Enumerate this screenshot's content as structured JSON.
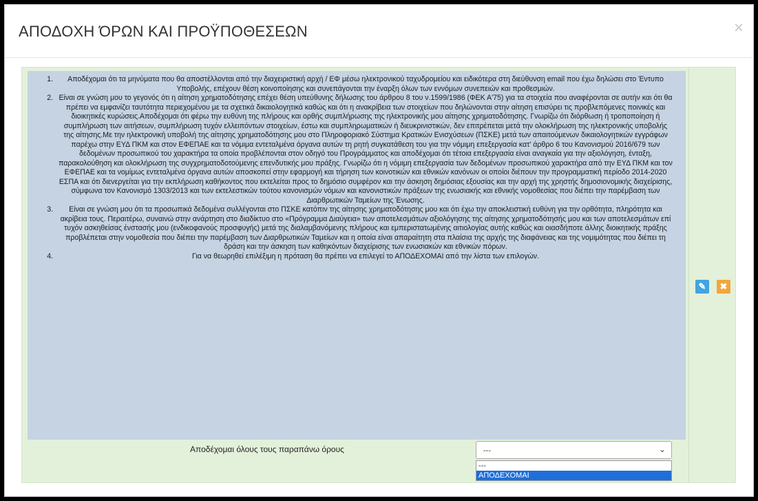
{
  "modal": {
    "title": "ΑΠΟΔΟΧΗ ΌΡΩΝ ΚΑΙ ΠΡΟΫΠΟΘΕΣΕΩΝ",
    "close_icon": "×"
  },
  "terms": [
    "Αποδέχομαι ότι τα μηνύματα που θα αποστέλλονται από την διαχειριστική αρχή / ΕΦ μέσω ηλεκτρονικού ταχυδρομείου και ειδικότερα στη διεύθυνση email που έχω δηλώσει στο Έντυπο Υποβολής, επέχουν θέση κοινοποίησης και συνεπάγονται την έναρξη όλων των εννόμων συνεπειών και προθεσμιών.",
    "Είναι σε γνώση μου το γεγονός ότι η αίτηση χρηματοδότησης επέχει θέση υπεύθυνης δήλωσης του άρθρου 8 του ν.1599/1986 (ΦΕΚ Α'75) για τα στοιχεία που αναφέρονται σε αυτήν και ότι θα πρέπει να εμφανίζει ταυτότητα περιεχομένου με τα σχετικά δικαιολογητικά καθώς και ότι η ανακρίβεια των στοιχείων που δηλώνονται στην αίτηση επισύρει τις προβλεπόμενες ποινικές και διοικητικές κυρώσεις.Αποδέχομαι ότι φέρω την ευθύνη της πλήρους και ορθής συμπλήρωσης της ηλεκτρονικής μου αίτησης χρηματοδότησης. Γνωρίζω ότι διόρθωση ή τροποποίηση ή συμπλήρωση των αιτήσεων, συμπλήρωση τυχόν ελλειπόντων στοιχείων, έστω και συμπληρωματικών ή διευκρινιστικών, δεν επιτρέπεται μετά την ολοκλήρωση της ηλεκτρονικής υποβολής της αίτησης.Με την ηλεκτρονική υποβολή της αίτησης χρηματοδότησης μου στο Πληροφοριακό Σύστημα Κρατικών Ενισχύσεων (ΠΣΚΕ) μετά των απαιτούμενων δικαιολογητικών εγγράφων παρέχω στην ΕΥΔ ΠΚΜ και στον ΕΦΕΠΑΕ και τα νόμιμα εντεταλμένα όργανα αυτών τη ρητή συγκατάθεση του για την νόμιμη επεξεργασία κατ' άρθρο 6 του Κανονισμού 2016/679 των δεδομένων προσωπικού του χαρακτήρα τα οποία προβλέπονται στον οδηγό του Προγράμματος και αποδέχομαι ότι τέτοια επεξεργασία είναι αναγκαία για την αξιολόγηση, ένταξη, παρακολούθηση και ολοκλήρωση της συγχρηματοδοτούμενης επενδυτικής μου πράξης. Γνωρίζω ότι η νόμιμη επεξεργασία των δεδομένων προσωπικού χαρακτήρα από την ΕΥΔ ΠΚΜ και τον ΕΦΕΠΑΕ και τα νομίμως εντεταλμένα όργανα αυτών αποσκοπεί στην εφαρμογή και τήρηση των κοινοτικών και εθνικών κανόνων οι οποίοι διέπουν την προγραμματική περίοδο 2014-2020 ΕΣΠΑ και ότι διενεργείται για την εκπλήρωση καθήκοντος που εκτελείται προς το δημόσιο συμφέρον και την άσκηση δημόσιας εξουσίας και την αρχή της χρηστής δημοσιονομικής διαχείρισης, σύμφωνα τον Κανονισμό 1303/2013 και των εκτελεστικών τούτου κανονισμών νόμων και κανονιστικών πράξεων της ενωσιακής και εθνικής νομοθεσίας που διέπει την παρέμβαση των Διαρθρωτικών Ταμείων της Ένωσης.",
    "Είναι σε γνώση μου ότι τα προσωπικά δεδομένα συλλέγονται στο ΠΣΚΕ κατόπιν της αίτησης χρηματοδότησης μου και ότι έχω την αποκλειστική ευθύνη για την ορθότητα, πληρότητα και ακρίβεια τους. Περαιτέρω, συναινώ στην ανάρτηση στο διαδίκτυο στο «Πρόγραμμα Διαύγεια» των αποτελεσμάτων αξιολόγησης της αίτησης χρηματοδότησής μου και των αποτελεσμάτων επί τυχόν ασκηθείσας ένστασής μου (ενδικοφανούς προσφυγής) μετά της διαλαμβανόμενης πλήρους και εμπεριστατωμένης αιτιολογίας αυτής καθώς και οιασδήποτε άλλης διοικητικής πράξης προβλέπεται στην νομοθεσία που διέπει την παρέμβαση των Διαρθρωτικών Ταμείων και η οποία είναι απαραίτητη στα πλαίσια της αρχής της διαφάνειας και της νομιμότητας που διέπει τη δράση και την άσκηση των καθηκόντων διαχείρισης των ενωσιακών και εθνικών πόρων.",
    "Για να θεωρηθεί επιλέξιμη η πρόταση θα πρέπει να επιλεγεί το ΑΠΟΔΕΧΟΜΑΙ από την λίστα των επιλογών."
  ],
  "accept": {
    "label": "Αποδέχομαι όλους τους παραπάνω όρους",
    "selected_value": "---",
    "options": [
      "---",
      "ΑΠΟΔΕΧΟΜΑΙ"
    ],
    "highlighted_option": "ΑΠΟΔΕΧΟΜΑΙ"
  },
  "actions": {
    "edit_icon": "edit-icon",
    "delete_icon": "close-icon",
    "edit_color": "#42a4e2",
    "delete_color": "#f2a63c"
  }
}
